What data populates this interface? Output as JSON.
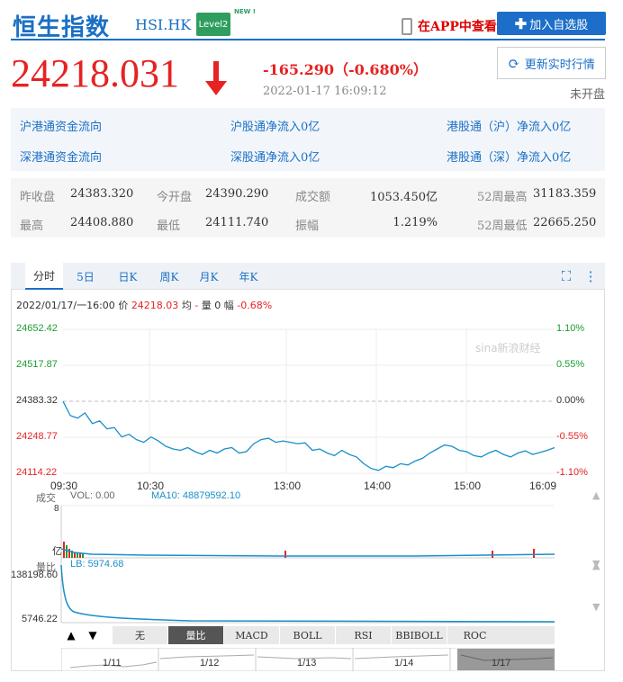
{
  "header": {
    "title": "恒生指数",
    "code": "HSI.HK",
    "level2": "Level2",
    "new_badge": "NEW !",
    "app_link": "在APP中查看",
    "add_button": "加入自选股"
  },
  "quote": {
    "price": "24218.031",
    "change": "-165.290（-0.680%）",
    "timestamp": "2022-01-17 16:09:12",
    "refresh": "更新实时行情",
    "status": "未开盘"
  },
  "flow": {
    "hk_north": "沪港通资金流向",
    "sh_in": "沪股通净流入0亿",
    "hk_sh": "港股通（沪）净流入0亿",
    "sz_north": "深港通资金流向",
    "sz_in": "深股通净流入0亿",
    "hk_sz": "港股通（深）净流入0亿"
  },
  "stats": [
    {
      "label": "昨收盘",
      "value": "24383.320"
    },
    {
      "label": "今开盘",
      "value": "24390.290"
    },
    {
      "label": "成交额",
      "value": "1053.450亿"
    },
    {
      "label": "52周最高",
      "value": "31183.359"
    },
    {
      "label": "最高",
      "value": "24408.880"
    },
    {
      "label": "最低",
      "value": "24111.740"
    },
    {
      "label": "振幅",
      "value": "1.219%"
    },
    {
      "label": "52周最低",
      "value": "22665.250"
    }
  ],
  "tabs": [
    "分时",
    "5日",
    "日K",
    "周K",
    "月K",
    "年K"
  ],
  "info": {
    "range": "2022/01/17/一16:00",
    "price_label": "价",
    "price": "24218.03",
    "avg_label": "均",
    "avg": "-",
    "vol_label": "量",
    "vol": "0",
    "amp_label": "幅",
    "amp": "-0.68%"
  },
  "watermark": "sina新浪财经",
  "colors": {
    "accent": "#1a6fc4",
    "down": "#e62222",
    "up": "#1a9e2e",
    "line": "#1a8fc8"
  },
  "volume": {
    "label": "成交",
    "vol": "VOL: 0.00",
    "ma": "MA10: 48879592.10",
    "top": "8",
    "bottom": "亿"
  },
  "lb": {
    "label": "量比",
    "value": "LB: 5974.68",
    "top": "138198.60",
    "bottom": "5746.22"
  },
  "indicators": [
    "无",
    "量比",
    "MACD",
    "BOLL",
    "RSI",
    "BBIBOLL",
    "ROC"
  ],
  "days": [
    "1/11",
    "1/12",
    "1/13",
    "1/14",
    "1/17"
  ],
  "chart_data": {
    "type": "line",
    "y_left_ticks": [
      "24652.42",
      "24517.87",
      "24383.32",
      "24248.77",
      "24114.22"
    ],
    "y_right_ticks": [
      "1.10%",
      "0.55%",
      "0.00%",
      "-0.55%",
      "-1.10%"
    ],
    "x_ticks": [
      "09:30",
      "10:30",
      "13:00",
      "14:00",
      "15:00",
      "16:09"
    ],
    "ylim": [
      24114.22,
      24652.42
    ],
    "reference": 24383.32,
    "series": [
      {
        "values": [
          24383,
          24330,
          24320,
          24340,
          24300,
          24310,
          24280,
          24285,
          24250,
          24260,
          24240,
          24230,
          24250,
          24235,
          24215,
          24205,
          24200,
          24210,
          24195,
          24185,
          24200,
          24190,
          24205,
          24210,
          24190,
          24195,
          24225,
          24240,
          24245,
          24230,
          24235,
          24230,
          24225,
          24228,
          24200,
          24205,
          24190,
          24180,
          24200,
          24185,
          24175,
          24150,
          24132,
          24125,
          24140,
          24135,
          24150,
          24145,
          24160,
          24170,
          24190,
          24205,
          24220,
          24215,
          24200,
          24195,
          24180,
          24175,
          24190,
          24200,
          24185,
          24175,
          24190,
          24198,
          24185,
          24192,
          24200,
          24210
        ]
      }
    ]
  }
}
